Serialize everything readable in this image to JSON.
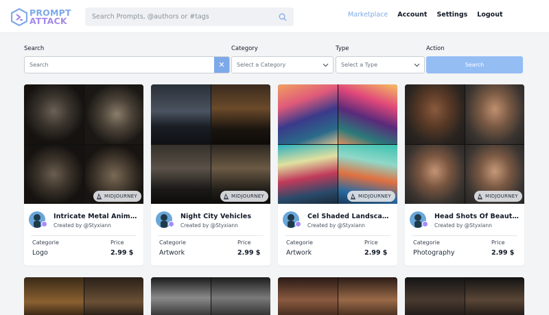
{
  "header": {
    "logo_line1": "PROMPT",
    "logo_line2": "ATTACK",
    "search_placeholder": "Search Prompts, @authors or #tags",
    "nav": [
      "Marketplace",
      "Account",
      "Settings",
      "Logout"
    ],
    "active_nav": "Marketplace"
  },
  "filters": {
    "search_label": "Search",
    "search_placeholder": "Search",
    "clear_symbol": "✕",
    "category_label": "Category",
    "category_selected": "Select a Category",
    "type_label": "Type",
    "type_selected": "Select a Type",
    "action_label": "Action",
    "action_button": "Search"
  },
  "card_labels": {
    "badge": "MIDJOURNEY",
    "category_label": "Categorie",
    "price_label": "Price"
  },
  "cards": [
    {
      "title": "Intricate Metal Animal Shields",
      "author": "Created by @Styxiann",
      "category": "Logo",
      "price": "2.99 $"
    },
    {
      "title": "Night City Vehicles",
      "author": "Created by @Styxiann",
      "category": "Artwork",
      "price": "2.99 $"
    },
    {
      "title": "Cel Shaded Landscapes",
      "author": "Created by @Styxiann",
      "category": "Artwork",
      "price": "2.99 $"
    },
    {
      "title": "Head Shots Of Beautiful Women",
      "author": "Created by @Styxiann",
      "category": "Photography",
      "price": "2.99 $"
    }
  ],
  "colors": {
    "accent": "#7ea9e8",
    "accent_secondary": "#a58be8",
    "search_button": "#94bdf4",
    "page_bg": "#f3f4f6"
  },
  "icons": {
    "logo": "hexagon-chevron-icon",
    "header_search": "search-icon",
    "select": "chevron-down-icon",
    "badge": "midjourney-sail-icon",
    "avatar_check": "verified-check-icon"
  }
}
